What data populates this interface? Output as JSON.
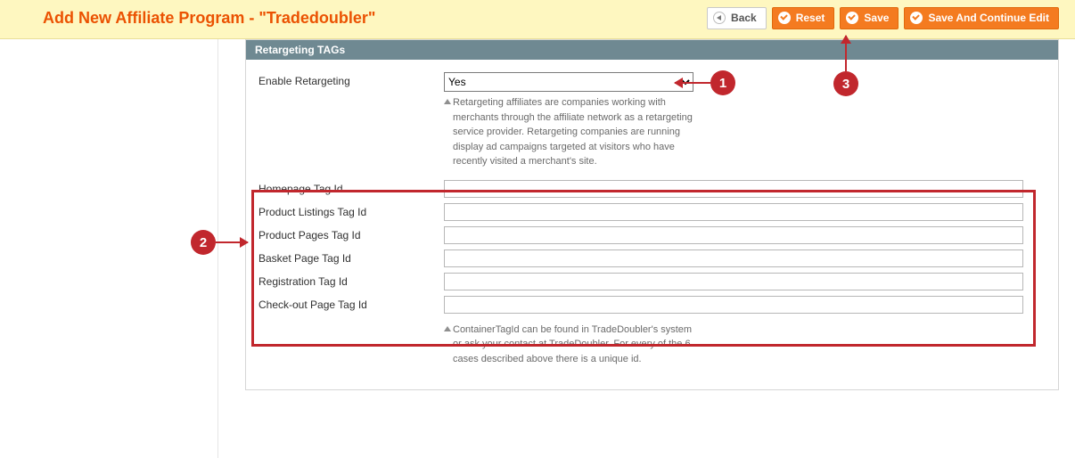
{
  "header": {
    "title": "Add New Affiliate Program - \"Tradedoubler\"",
    "buttons": {
      "back": "Back",
      "reset": "Reset",
      "save": "Save",
      "save_continue": "Save And Continue Edit"
    }
  },
  "panel": {
    "title": "Retargeting TAGs"
  },
  "form": {
    "enable_retargeting_label": "Enable Retargeting",
    "enable_retargeting_value": "Yes",
    "enable_retargeting_hint": "Retargeting affiliates are companies working with merchants through the affiliate network as a retargeting service provider. Retargeting companies are running display ad campaigns targeted at visitors who have recently visited a merchant's site.",
    "fields": {
      "homepage": {
        "label": "Homepage Tag Id",
        "value": ""
      },
      "product_listings": {
        "label": "Product Listings Tag Id",
        "value": ""
      },
      "product_pages": {
        "label": "Product Pages Tag Id",
        "value": ""
      },
      "basket_page": {
        "label": "Basket Page Tag Id",
        "value": ""
      },
      "registration": {
        "label": "Registration Tag Id",
        "value": ""
      },
      "checkout_page": {
        "label": "Check-out Page Tag Id",
        "value": ""
      }
    },
    "container_hint": "ContainerTagId can be found in TradeDoubler's system or ask your contact at TradeDoubler. For every of the 6 cases described above there is a unique id."
  },
  "callouts": {
    "c1": "1",
    "c2": "2",
    "c3": "3"
  }
}
